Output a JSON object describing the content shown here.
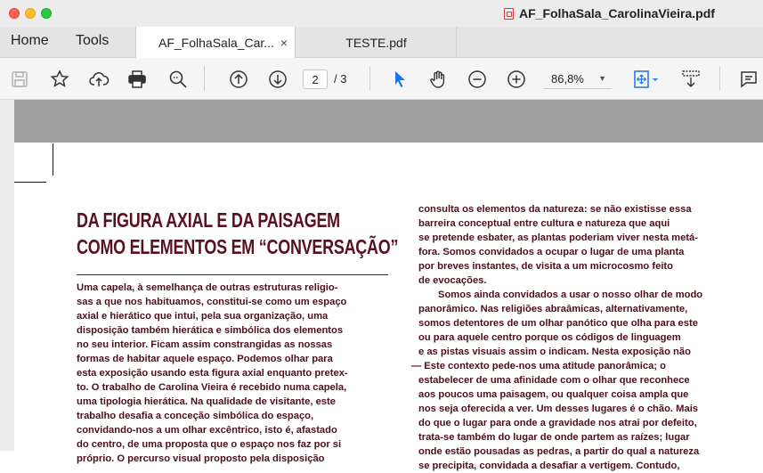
{
  "window": {
    "title": "AF_FolhaSala_CarolinaVieira.pdf"
  },
  "nav": {
    "home": "Home",
    "tools": "Tools"
  },
  "tabs": [
    {
      "label": "AF_FolhaSala_Car...",
      "close": "×"
    },
    {
      "label": "TESTE.pdf"
    }
  ],
  "toolbar": {
    "page_current": "2",
    "page_total": "/ 3",
    "zoom": "86,8%",
    "accent": "#1a73e8"
  },
  "document": {
    "heading": [
      "DA FIGURA AXIAL E DA PAISAGEM",
      "COMO ELEMENTOS EM “CONVERSAÇÃO”"
    ],
    "col1": [
      "Uma capela, à semelhança de outras estruturas religio-",
      "sas a que nos habituamos, constitui-se como um espaço",
      "axial e hierático que intui, pela sua organização, uma",
      "disposição também hierática e simbólica dos elementos",
      "no seu interior. Ficam assim constrangidas as nossas",
      "formas de habitar aquele espaço. Podemos olhar para",
      "esta exposição usando esta figura axial enquanto pretex-",
      "to. O trabalho de Carolina Vieira é recebido numa capela,",
      "uma tipologia hierática. Na qualidade de visitante, este",
      "trabalho desafia a conceção simbólica do espaço,",
      "convidando-nos a um olhar excêntrico, isto é, afastado",
      "do centro, de uma proposta que o espaço nos faz por si",
      "próprio. O percurso visual proposto pela disposição"
    ],
    "col2a": [
      "consulta os elementos da natureza:  se não existisse essa",
      "barreira conceptual entre cultura e natureza que aqui",
      "se pretende esbater, as plantas poderiam viver nesta metá-",
      "fora. Somos convidados a ocupar o lugar de uma planta",
      "por breves instantes, de visita a um microcosmo feito",
      "de evocações."
    ],
    "col2b_first": "Somos ainda convidados a usar o nosso olhar de modo",
    "col2b": [
      "panorâmico. Nas religiões abraâmicas, alternativamente,",
      "somos detentores de um olhar panótico que olha para este",
      "ou para aquele centro porque os códigos de linguagem",
      "e as pistas visuais assim o indicam. Nesta exposição não",
      "— Este contexto pede-nos uma atitude panorâmica; o",
      "estabelecer de uma afinidade com o olhar que reconhece",
      "aos poucos uma paisagem, ou qualquer coisa ampla que",
      "nos seja oferecida a ver. Um desses lugares é o chão. Mais",
      "do que o lugar para onde a gravidade nos atrai por defeito,",
      "trata-se também do lugar de onde partem as raízes; lugar",
      "onde estão pousadas as pedras, a partir do qual a natureza",
      "se precipita, convidada a desafiar a vertigem. Contudo,"
    ]
  }
}
